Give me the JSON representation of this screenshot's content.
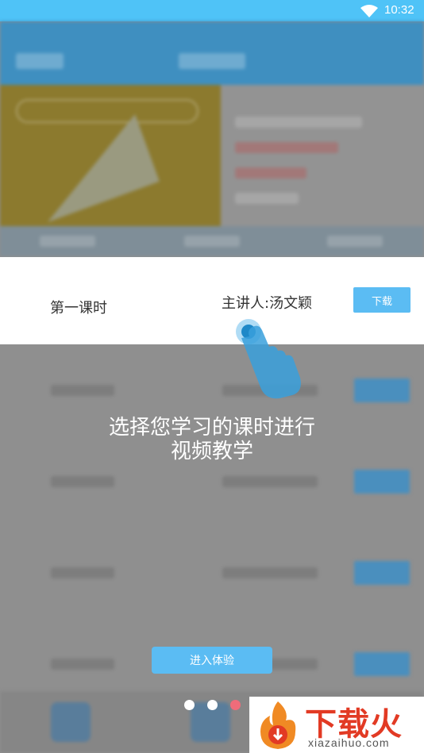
{
  "status_bar": {
    "time": "10:32"
  },
  "highlight_row": {
    "lesson": "第一课时",
    "lecturer": "主讲人:汤文颖",
    "download_label": "下载"
  },
  "guide": {
    "line1": "选择您学习的课时进行",
    "line2": "视频教学"
  },
  "enter_button": {
    "label": "进入体验"
  },
  "page_indicator": {
    "total": 3,
    "active": 3
  },
  "watermark": {
    "brand_cn": "下载火",
    "brand_en": "xiazaihuo.com"
  },
  "colors": {
    "accent": "#5bbcf3",
    "status_bar": "#4fc3f7",
    "active_dot": "#ef6c7a",
    "brand_red": "#e23a24"
  }
}
